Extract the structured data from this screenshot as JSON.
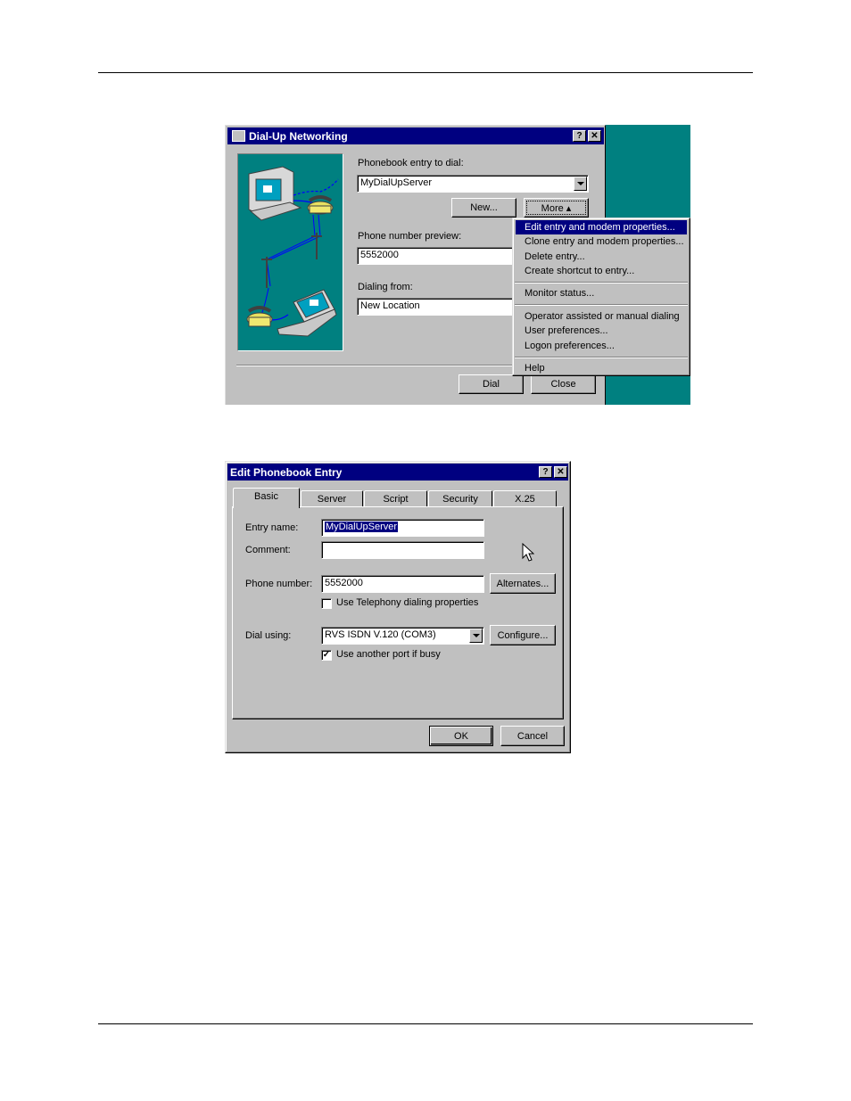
{
  "dun": {
    "title": "Dial-Up Networking",
    "help_btn": "?",
    "close_btn": "✕",
    "phonebook_label": "Phonebook entry to dial:",
    "phonebook_value": "MyDialUpServer",
    "new_button": "New...",
    "more_button": "More ▴",
    "preview_label": "Phone number preview:",
    "preview_value": "5552000",
    "dialing_from_label": "Dialing from:",
    "dialing_from_value": "New Location",
    "dial_button": "Dial",
    "close_button": "Close",
    "menu": [
      "Edit entry and modem properties...",
      "Clone entry and modem properties...",
      "Delete entry...",
      "Create shortcut to entry...",
      "Monitor status...",
      "Operator assisted or manual dialing",
      "User preferences...",
      "Logon preferences...",
      "Help"
    ]
  },
  "edit": {
    "title": "Edit Phonebook Entry",
    "help_btn": "?",
    "close_btn": "✕",
    "tabs": [
      "Basic",
      "Server",
      "Script",
      "Security",
      "X.25"
    ],
    "entry_name_label": "Entry name:",
    "entry_name_value": "MyDialUpServer",
    "comment_label": "Comment:",
    "comment_value": "",
    "phone_label": "Phone number:",
    "phone_value": "5552000",
    "alternates_button": "Alternates...",
    "telephony_label": "Use Telephony dialing properties",
    "dial_using_label": "Dial using:",
    "dial_using_value": "RVS ISDN V.120 (COM3)",
    "configure_button": "Configure...",
    "another_port_label": "Use another port if busy",
    "checkmark": "✓",
    "ok_button": "OK",
    "cancel_button": "Cancel"
  },
  "colors": {
    "titlebar": "#000080",
    "desktop": "#008080",
    "face": "#c0c0c0"
  }
}
